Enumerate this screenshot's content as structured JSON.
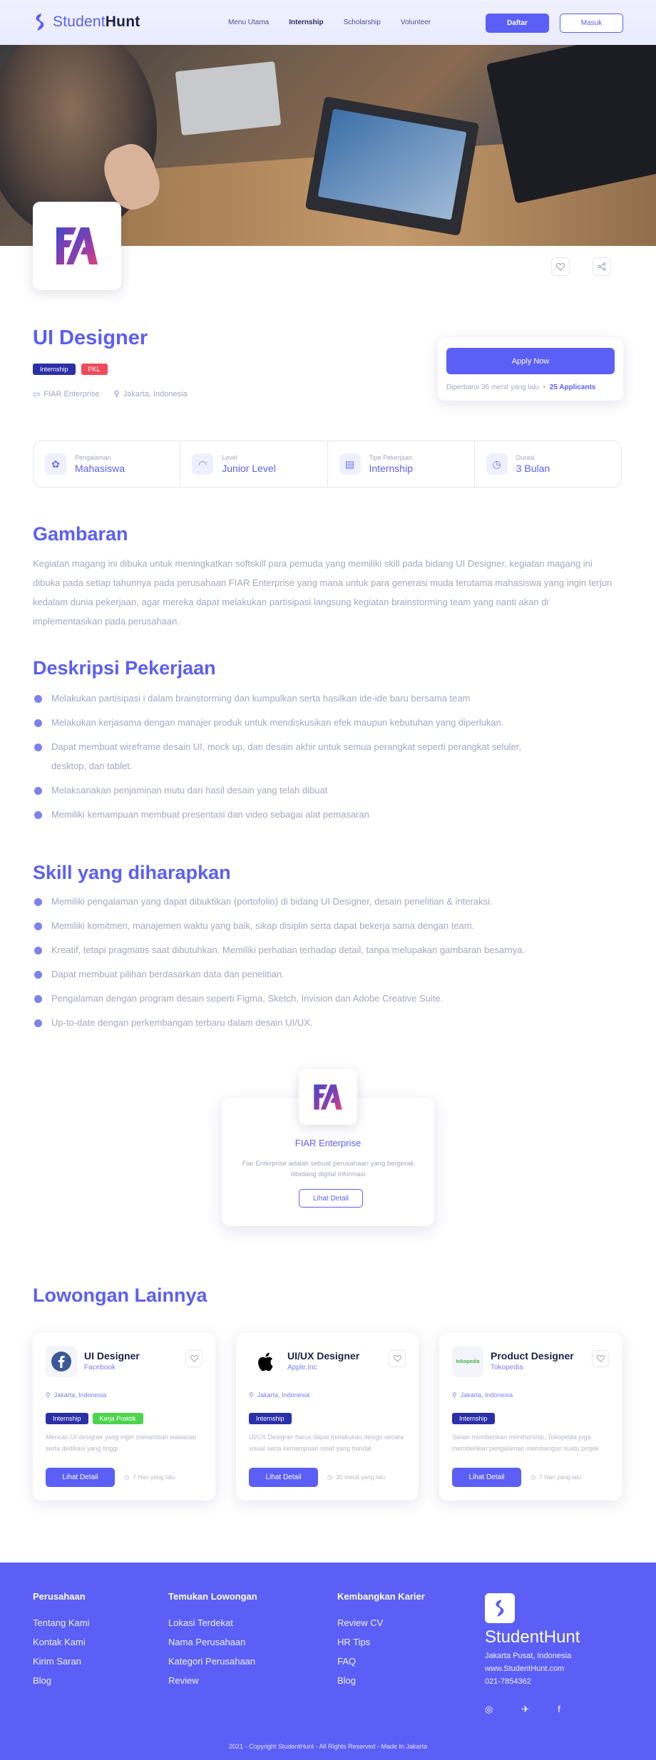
{
  "nav": {
    "logo_prefix": "Student",
    "logo_bold": "Hunt",
    "menu": [
      "Menu Utama",
      "Internship",
      "Scholarship",
      "Volunteer"
    ],
    "daftar": "Daftar",
    "masuk": "Masuk"
  },
  "job": {
    "title": "UI Designer",
    "badges": [
      "Internship",
      "PKL"
    ],
    "company": "FIAR Enterprise",
    "location": "Jakarta, Indonesia",
    "apply_label": "Apply Now",
    "updated": "Diperbarui 36 menit yang lalu",
    "applicants": "25 Applicants"
  },
  "info": [
    {
      "label": "Pengalaman",
      "value": "Mahasiswa",
      "icon": "experience-icon"
    },
    {
      "label": "Level",
      "value": "Junior Level",
      "icon": "gauge-icon"
    },
    {
      "label": "Tipe Pekerjaan",
      "value": "Internship",
      "icon": "briefcase-icon"
    },
    {
      "label": "Durasi",
      "value": "3 Bulan",
      "icon": "clock-icon"
    }
  ],
  "gambaran": {
    "title": "Gambaran",
    "text": "Kegiatan magang ini dibuka untuk meningkatkan softskill para pemuda yang memiliki skill pada bidang UI Designer, kegiatan magang ini dibuka pada setiap tahunnya pada  perusahaan FIAR Enterprise yang mana untuk para generasi muda terutama mahasiswa yang ingin terjun kedalam dunia pekerjaan, agar mereka dapat melakukan partisipasi langsung kegiatan brainstorming team yang nanti akan di implementasikan pada perusahaan."
  },
  "deskripsi": {
    "title": "Deskripsi Pekerjaan",
    "items": [
      "Melakukan partisipasi i dalam brainstorming dan kumpulkan serta hasilkan ide-ide baru bersama team",
      "Melakukan kerjasama dengan manajer produk untuk mendiskusikan efek maupun kebutuhan yang diperlukan.",
      "Dapat membuat wireframe desain UI, mock up, dan desain akhir untuk semua perangkat seperti perangkat seluler, desktop, dan tablet.",
      "Melaksanakan penjaminan mutu dari hasil desain yang telah dibuat",
      "Memiliki kemampuan membuat presentasi dan video sebagai alat pemasaran"
    ]
  },
  "skill": {
    "title": "Skill yang diharapkan",
    "items": [
      "Memiliki pengalaman yang dapat dibuktikan (portofolio) di bidang UI Designer, desain penelitian & interaksi.",
      " Memiliki komitmen, manajemen waktu yang baik, sikap disiplin serta dapat bekerja sama dengan team.",
      "Kreatif, tetapi pragmatis saat dibutuhkan. Memiliki perhatian terhadap detail, tanpa melupakan gambaran besarnya.",
      "Dapat membuat pilihan berdasarkan data dan penelitian.",
      "Pengalaman dengan program desain seperti Figma, Sketch, Invision dan Adobe Creative Suite.",
      "Up-to-date dengan perkembangan terbaru dalam desain UI/UX."
    ]
  },
  "company_card": {
    "name": "FIAR Enterprise",
    "desc": "Fiar Enterprise adalah sebuat perusahaan yang bergerak dibidang  digital informasi",
    "button": "Lihat Detail"
  },
  "lainnya": {
    "title": "Lowongan Lainnya",
    "cards": [
      {
        "title": "UI Designer",
        "company": "Facebook",
        "location": "Jakarta, Indonesia",
        "badges": [
          "Internship",
          "Kerja Praktik"
        ],
        "desc": "Mencari UI designer yang ingin menambah wawasan serta dedikasi yang tinggi",
        "button": "Lihat Detail",
        "time": "7 Hari yang lalu",
        "logo": "facebook-logo-icon"
      },
      {
        "title": "UI/UX Designer",
        "company": "Apple.Inc",
        "location": "Jakarta, Indonesia",
        "badges": [
          "Internship"
        ],
        "desc": "UI/UX Designer harus dapat melakukan design secara visual serta kemampuan reset yang handal",
        "button": "Lihat Detail",
        "time": "30 menit yang lalu",
        "logo": "apple-logo-icon"
      },
      {
        "title": "Product Designer",
        "company": "Tokopedia",
        "location": "Jakarta, Indonesia",
        "badges": [
          "Internship"
        ],
        "desc": "Selain memberikan menthorship, Tokopedia juga memberikan pengalaman membangun suatu projek",
        "button": "Lihat Detail",
        "time": "7 Hari yang lalu",
        "logo": "tokopedia-logo-icon",
        "logo_text": "tokopedia"
      }
    ]
  },
  "footer": {
    "col1": {
      "title": "Perusahaan",
      "links": [
        "Tentang Kami",
        "Kontak Kami",
        "Kirim Saran",
        "Blog"
      ]
    },
    "col2": {
      "title": "Temukan Lowongan",
      "links": [
        "Lokasi Terdekat",
        "Nama Perusahaan",
        "Kategori Perusahaan",
        "Review"
      ]
    },
    "col3": {
      "title": "Kembangkan Karier",
      "links": [
        "Review CV",
        "HR Tips",
        "FAQ",
        "Blog"
      ]
    },
    "brand": "StudentHunt",
    "address": "Jakarta Pusat, Indonesia",
    "website": "www.StudentHunt.com",
    "phone": "021-7854362",
    "copyright": "2021 - Copyright StudentHunt  - All Rights Reserved -  Made In Jakarta"
  },
  "colors": {
    "accent": "#5b5ff5",
    "badge_blue": "#2b2fa8",
    "badge_red": "#ef4b5c",
    "badge_green": "#4cd44e"
  }
}
